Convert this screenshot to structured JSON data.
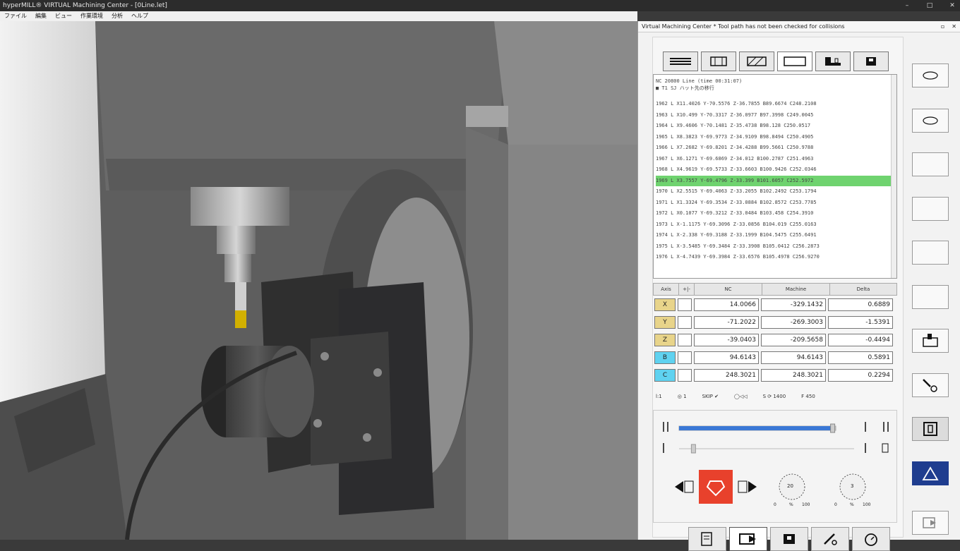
{
  "window": {
    "title": "hyperMILL® VIRTUAL Machining Center - [0Line.let]"
  },
  "menu": [
    "ファイル",
    "編集",
    "ビュー",
    "作業環境",
    "分析",
    "ヘルプ"
  ],
  "panel": {
    "title": "Virtual Machining Center * Tool path has not been checked for collisions",
    "tabs": [
      "nc-list-icon",
      "machine-icon",
      "stock-icon",
      "blank-icon",
      "table-icon",
      "part-icon"
    ],
    "nc_header": [
      "NC 20800 Line (time 00:31:07)",
      "■ T1 SJ ハット先の移行"
    ],
    "nc_lines": [
      "1962 L X11.4026 Y-70.5576 Z-36.7855 B89.6674 C248.2108",
      "1963 L X10.499 Y-70.3317 Z-36.0977 B97.3998 C249.0045",
      "1964 L X9.4606 Y-70.1481 Z-35.4738 B98.128 C250.0517",
      "1965 L X8.3823 Y-69.9773 Z-34.9109 B98.8494 C250.4905",
      "1966 L X7.2682 Y-69.8201 Z-34.4288 B99.5661 C250.9788",
      "1967 L X6.1271 Y-69.6869 Z-34.012 B100.2787 C251.4963",
      "1968 L X4.9619 Y-69.5733 Z-33.6603 B100.9426 C252.0346",
      "1969 L X3.7557 Y-69.4796 Z-33.399 B101.6057 C252.5972",
      "1970 L X2.5515 Y-69.4063 Z-33.2055 B102.2492 C253.1794",
      "1971 L X1.3324 Y-69.3534 Z-33.0884 B102.8572 C253.7785",
      "1972 L X0.1077 Y-69.3212 Z-33.0484 B103.458 C254.3910",
      "1973 L X-1.1175 Y-69.3096 Z-33.0856 B104.019 C255.0163",
      "1974 L X-2.338 Y-69.3188 Z-33.1999 B104.5475 C255.6491",
      "1975 L X-3.5485 Y-69.3484 Z-33.3908 B105.0412 C256.2873",
      "1976 L X-4.7439 Y-69.3984 Z-33.6576 B105.4978 C256.9270"
    ],
    "highlight_index": 7,
    "axes_header": [
      "Axis",
      "+|-",
      "NC",
      "Machine",
      "Delta"
    ],
    "axes": [
      {
        "label": "X",
        "nc": "14.0066",
        "machine": "-329.1432",
        "delta": "0.6889",
        "color": "#e8d48a"
      },
      {
        "label": "Y",
        "nc": "-71.2022",
        "machine": "-269.3003",
        "delta": "-1.5391",
        "color": "#e8d48a"
      },
      {
        "label": "Z",
        "nc": "-39.0403",
        "machine": "-209.5658",
        "delta": "-0.4494",
        "color": "#e8d48a"
      },
      {
        "label": "B",
        "nc": "94.6143",
        "machine": "94.6143",
        "delta": "0.5891",
        "color": "#5fd2f0"
      },
      {
        "label": "C",
        "nc": "248.3021",
        "machine": "248.3021",
        "delta": "0.2294",
        "color": "#5fd2f0"
      }
    ],
    "status": [
      "l:1",
      "◎ 1",
      "SKIP ✔",
      "◯◁◁",
      "S ⟳ 1400",
      "F 450"
    ],
    "dial1": {
      "value": "20",
      "min": "0",
      "unit": "%",
      "max": "100"
    },
    "dial2": {
      "value": "3",
      "min": "0",
      "unit": "%",
      "max": "100"
    },
    "progress_fraction": 0.98,
    "slider2_fraction": 0.07
  }
}
